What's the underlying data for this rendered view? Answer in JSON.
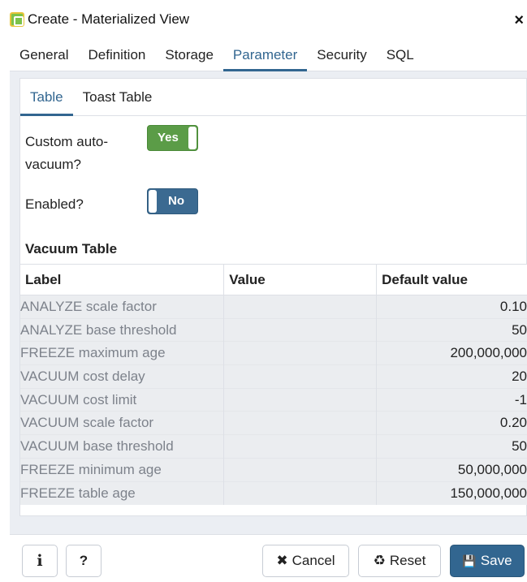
{
  "window": {
    "title": "Create - Materialized View",
    "close_icon": "×"
  },
  "tabs": [
    {
      "label": "General"
    },
    {
      "label": "Definition"
    },
    {
      "label": "Storage"
    },
    {
      "label": "Parameter",
      "active": true
    },
    {
      "label": "Security"
    },
    {
      "label": "SQL"
    }
  ],
  "subtabs": [
    {
      "label": "Table",
      "active": true
    },
    {
      "label": "Toast Table"
    }
  ],
  "form": {
    "custom_autovacuum": {
      "label_line1": "Custom auto-",
      "label_line2": "vacuum?",
      "value": "Yes"
    },
    "enabled": {
      "label": "Enabled?",
      "value": "No"
    }
  },
  "vacuum_table": {
    "title": "Vacuum Table",
    "headers": [
      "Label",
      "Value",
      "Default value"
    ],
    "rows": [
      {
        "label": "ANALYZE scale factor",
        "value": "",
        "default": "0.10"
      },
      {
        "label": "ANALYZE base threshold",
        "value": "",
        "default": "50"
      },
      {
        "label": "FREEZE maximum age",
        "value": "",
        "default": "200,000,000"
      },
      {
        "label": "VACUUM cost delay",
        "value": "",
        "default": "20"
      },
      {
        "label": "VACUUM cost limit",
        "value": "",
        "default": "-1"
      },
      {
        "label": "VACUUM scale factor",
        "value": "",
        "default": "0.20"
      },
      {
        "label": "VACUUM base threshold",
        "value": "",
        "default": "50"
      },
      {
        "label": "FREEZE minimum age",
        "value": "",
        "default": "50,000,000"
      },
      {
        "label": "FREEZE table age",
        "value": "",
        "default": "150,000,000"
      }
    ]
  },
  "footer": {
    "info_icon": "i",
    "help_icon": "?",
    "cancel_label": "Cancel",
    "cancel_icon": "✖",
    "reset_label": "Reset",
    "reset_icon": "♻",
    "save_label": "Save",
    "save_icon": "💾"
  },
  "colors": {
    "accent": "#326690",
    "toggle_on": "#5b9c47",
    "toggle_off": "#3b6a91"
  }
}
